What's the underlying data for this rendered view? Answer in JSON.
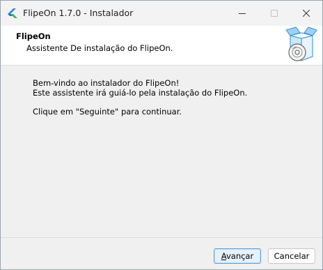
{
  "window": {
    "title": "FlipeOn 1.7.0 - Instalador",
    "controls": [
      "minimize-icon",
      "maximize-icon",
      "close-icon"
    ]
  },
  "header": {
    "title": "FlipeOn",
    "subtitle": "Assistente De instalação do FlipeOn.",
    "icon": "installer-box-icon"
  },
  "body": {
    "line1": "Bem-vindo ao instalador do FlipeOn!",
    "line2": "Este assistente irá guiá-lo pela instalação do FlipeOn.",
    "line3": "Clique em \"Seguinte\" para continuar."
  },
  "buttons": {
    "next_first": "A",
    "next_rest": "vançar",
    "cancel": "Cancelar"
  },
  "colors": {
    "accent": "#5b9bd5",
    "icon_blue": "#2f8fd8",
    "icon_green": "#4caf50"
  }
}
